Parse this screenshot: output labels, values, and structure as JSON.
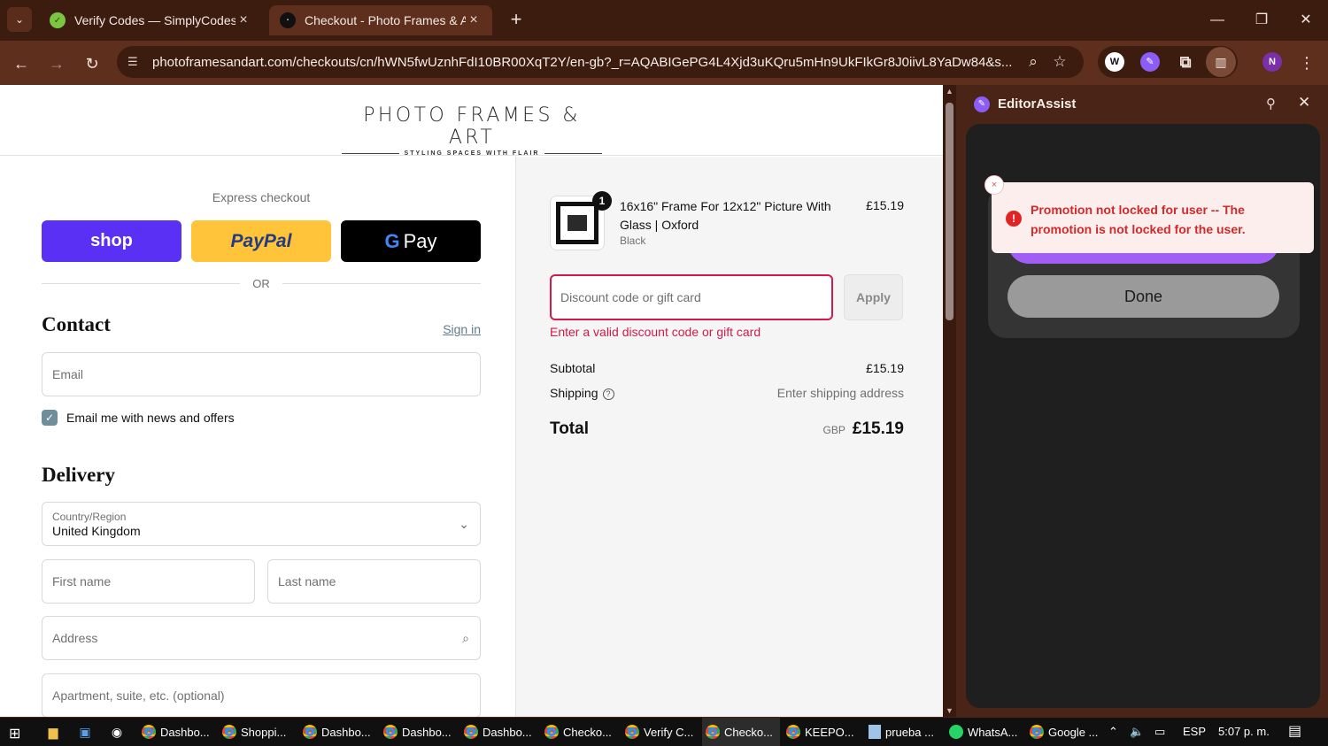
{
  "browser": {
    "tabs": [
      {
        "title": "Verify Codes — SimplyCodes",
        "active": false,
        "favicon": "simplycodes-icon"
      },
      {
        "title": "Checkout - Photo Frames & Art",
        "active": true,
        "favicon": "pfa-icon"
      }
    ],
    "url": "photoframesandart.com/checkouts/cn/hWN5fwUznhFdI10BR00XqT2Y/en-gb?_r=AQABIGePG4L4Xjd3uKQru5mHn9UkFIkGr8J0iivL8YaDw84&s...",
    "profile_initial": "N"
  },
  "store": {
    "brand": "PHOTO FRAMES & ART",
    "tagline": "STYLING SPACES WITH FLAIR"
  },
  "checkout": {
    "express_label": "Express checkout",
    "shop_label": "shop",
    "paypal_label": "PayPal",
    "gpay_g": "G",
    "gpay_label": "Pay",
    "or_label": "OR",
    "contact_title": "Contact",
    "sign_in": "Sign in",
    "email_placeholder": "Email",
    "news_label": "Email me with news and offers",
    "news_checked": true,
    "delivery_title": "Delivery",
    "country_label": "Country/Region",
    "country_value": "United Kingdom",
    "first_name_placeholder": "First name",
    "last_name_placeholder": "Last name",
    "address_placeholder": "Address",
    "apartment_placeholder": "Apartment, suite, etc. (optional)"
  },
  "summary": {
    "item": {
      "quantity": "1",
      "name": "16x16\" Frame For 12x12\" Picture With Glass | Oxford",
      "variant": "Black",
      "price": "£15.19"
    },
    "discount_placeholder": "Discount code or gift card",
    "apply_label": "Apply",
    "discount_error": "Enter a valid discount code or gift card",
    "subtotal_label": "Subtotal",
    "subtotal_value": "£15.19",
    "shipping_label": "Shipping",
    "shipping_value": "Enter shipping address",
    "total_label": "Total",
    "currency": "GBP",
    "total_value": "£15.19",
    "error_color": "#d11a4b"
  },
  "sidepanel": {
    "title": "EditorAssist",
    "toast_message": "Promotion not locked for user -- The promotion is not locked for the user.",
    "loading_label": "•••",
    "done_label": "Done",
    "accent": "#a05ef5"
  },
  "taskbar": {
    "items": [
      "Dashbo...",
      "Shoppi...",
      "Dashbo...",
      "Dashbo...",
      "Dashbo...",
      "Checko...",
      "Verify C...",
      "Checko...",
      "KEEPO...",
      "prueba ...",
      "WhatsA...",
      "Google ..."
    ],
    "language": "ESP",
    "time": "5:07 p. m."
  }
}
